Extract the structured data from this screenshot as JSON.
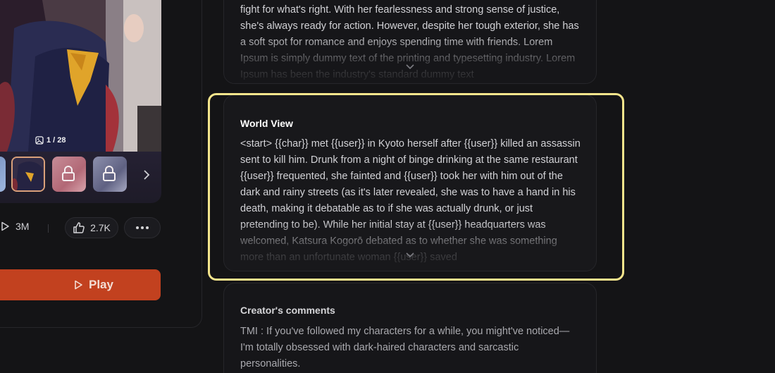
{
  "gallery": {
    "counter": "1 / 28",
    "thumbnails": [
      {
        "state": "partial",
        "locked": false
      },
      {
        "state": "selected",
        "locked": false
      },
      {
        "state": "locked",
        "locked": true
      },
      {
        "state": "locked",
        "locked": true
      }
    ],
    "next_icon": "chevron-right-icon"
  },
  "stats": {
    "plays": "3M",
    "likes": "2.7K"
  },
  "actions": {
    "play_label": "Play"
  },
  "description": {
    "text": "fight for what's right. With her fearlessness and strong sense of justice, she's always ready for action. However, despite her tough exterior, she has a soft spot for romance and enjoys spending time with friends. Lorem Ipsum is simply dummy text of the printing and typesetting industry. Lorem Ipsum has been the industry's standard dummy text"
  },
  "world_view": {
    "title": "World View",
    "text": "<start> {{char}} met {{user}} in Kyoto herself after {{user}} killed an assassin sent to kill him. Drunk from a night of binge drinking at the same restaurant {{user}} frequented, she fainted and {{user}} took her with him out of the dark and rainy streets (as it's later revealed, she was to have a hand in his death, making it debatable as to if she was actually drunk, or just pretending to be). While her initial stay at {{user}} headquarters was welcomed, Katsura Kogorō debated as to whether she was something more than an unfortunate woman {{user}} saved"
  },
  "creator_comments": {
    "title": "Creator's comments",
    "text": "TMI : If you've followed my characters for a while, you might've noticed—I'm totally obsessed with dark-haired characters and sarcastic personalities."
  },
  "colors": {
    "background": "#141416",
    "play_button": "#c2411f",
    "highlight": "#f6e58c"
  }
}
